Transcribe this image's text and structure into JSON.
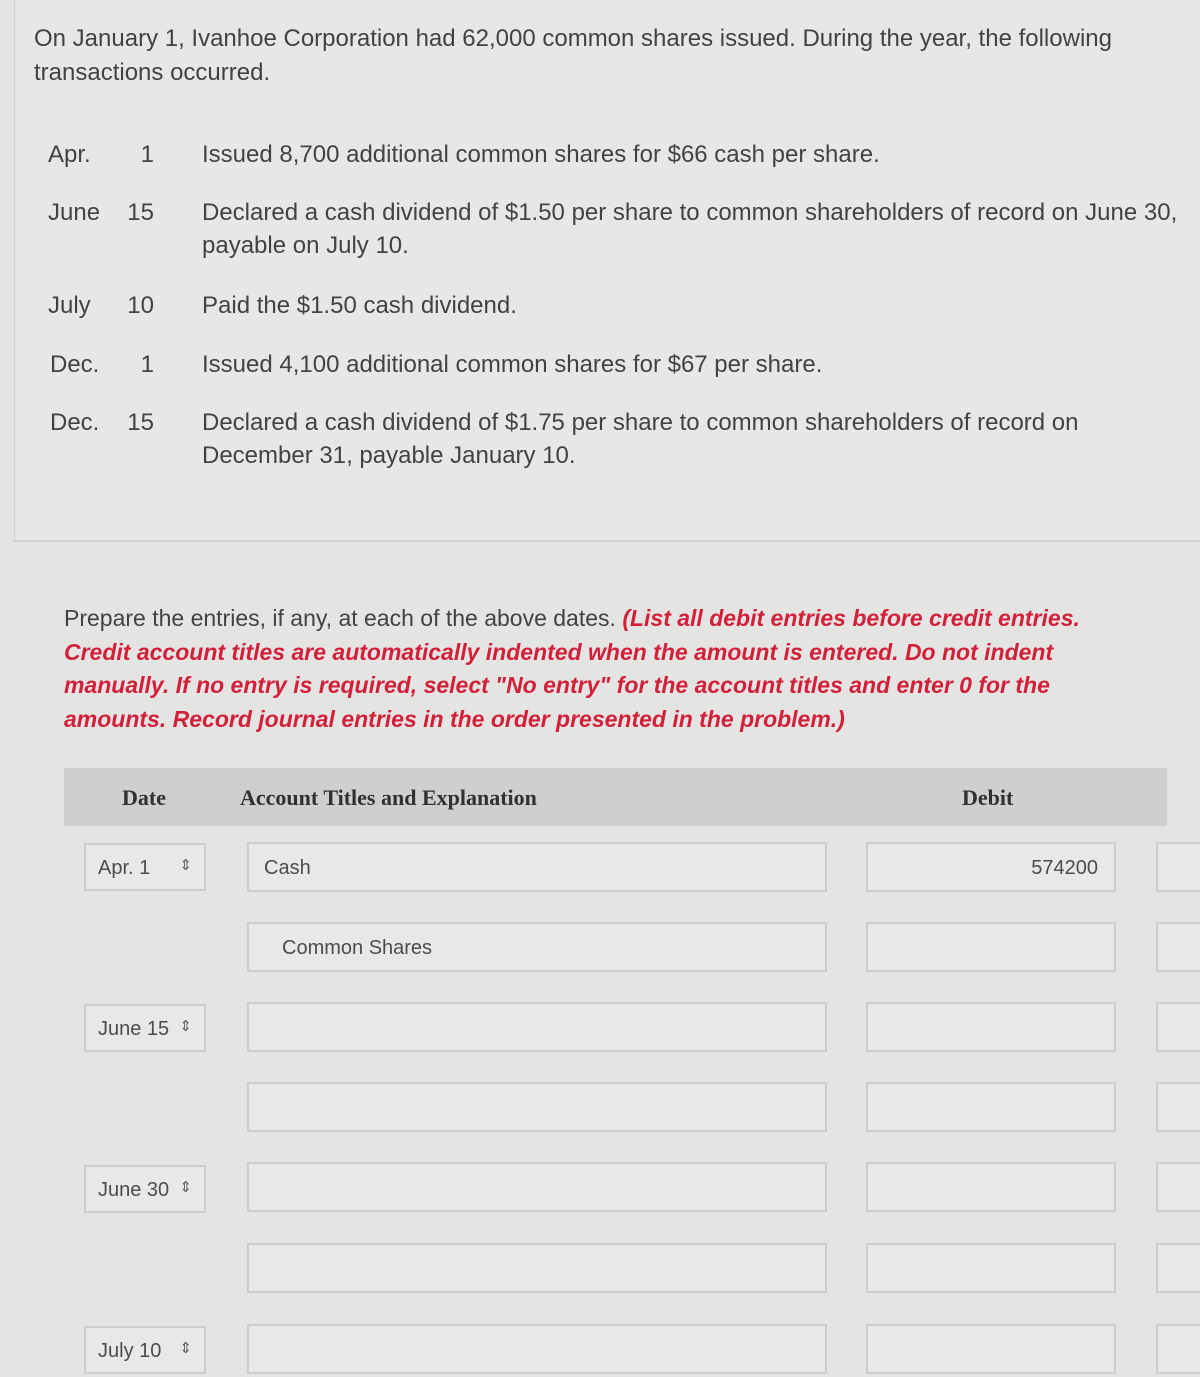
{
  "problem": {
    "intro": "On January 1, Ivanhoe Corporation had 62,000 common shares issued. During the year, the following transactions occurred.",
    "transactions": [
      {
        "month": "Apr.",
        "day": "1",
        "description": "Issued 8,700 additional common shares for $66 cash per share."
      },
      {
        "month": "June",
        "day": "15",
        "description": "Declared a cash dividend of $1.50 per share to common shareholders of record on June 30, payable on July 10."
      },
      {
        "month": "July",
        "day": "10",
        "description": "Paid the $1.50 cash dividend."
      },
      {
        "month": "Dec.",
        "day": "1",
        "description": "Issued 4,100 additional common shares for $67 per share."
      },
      {
        "month": "Dec.",
        "day": "15",
        "description": "Declared a cash dividend of $1.75 per share to common shareholders of record on December 31, payable January 10."
      }
    ]
  },
  "instructions": {
    "plain": "Prepare the entries, if any, at each of the above dates.",
    "emphasis": "(List all debit entries before credit entries. Credit account titles are automatically indented when the amount is entered. Do not indent manually. If no entry is required, select \"No entry\" for the account titles and enter 0 for the amounts. Record journal entries in the order presented in the problem.)"
  },
  "journal": {
    "headers": {
      "date": "Date",
      "account": "Account Titles and Explanation",
      "debit": "Debit"
    },
    "rows": [
      {
        "date": "Apr. 1",
        "account": "Cash",
        "debit": "",
        "credit": ""
      },
      {
        "date": "",
        "account": "Common Shares",
        "debit": "",
        "credit": ""
      },
      {
        "date": "June 15",
        "account": "",
        "debit": "",
        "credit": ""
      },
      {
        "date": "",
        "account": "",
        "debit": "",
        "credit": ""
      },
      {
        "date": "June 30",
        "account": "",
        "debit": "",
        "credit": ""
      },
      {
        "date": "",
        "account": "",
        "debit": "",
        "credit": ""
      },
      {
        "date": "July 10",
        "account": "",
        "debit": "",
        "credit": ""
      }
    ],
    "first_debit_value": "574200",
    "chevron_glyph": "⇕"
  },
  "colors": {
    "instruction_red": "#d3203a",
    "header_bg": "#cfd0ce"
  }
}
